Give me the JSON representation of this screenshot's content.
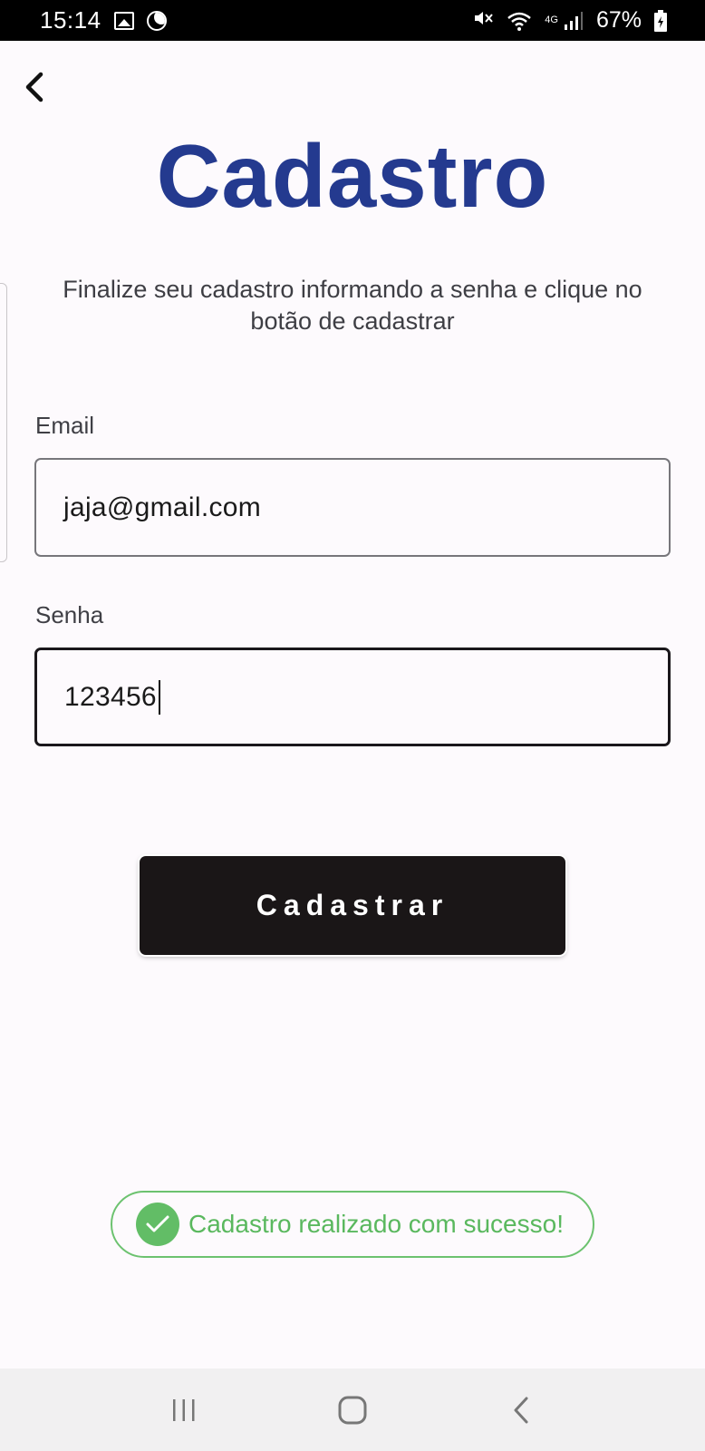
{
  "status_bar": {
    "time": "15:14",
    "network": "4G",
    "battery": "67%",
    "icons": [
      "gallery-icon",
      "moon-icon",
      "mute-icon",
      "wifi-icon",
      "signal-icon",
      "battery-icon"
    ]
  },
  "header": {
    "back_icon": "chevron-left-icon",
    "title": "Cadastro"
  },
  "form": {
    "subtitle": "Finalize seu cadastro informando a senha e clique no botão de cadastrar",
    "email": {
      "label": "Email",
      "value": "jaja@gmail.com"
    },
    "senha": {
      "label": "Senha",
      "value": "123456"
    },
    "submit_label": "Cadastrar"
  },
  "toast": {
    "icon": "check-circle-icon",
    "message": "Cadastro realizado com sucesso!"
  },
  "nav_bar": {
    "icons": [
      "recent-apps-icon",
      "home-icon",
      "back-icon"
    ]
  },
  "colors": {
    "title": "#243a8f",
    "button_bg": "#1a1617",
    "toast_green": "#5ab85e"
  }
}
